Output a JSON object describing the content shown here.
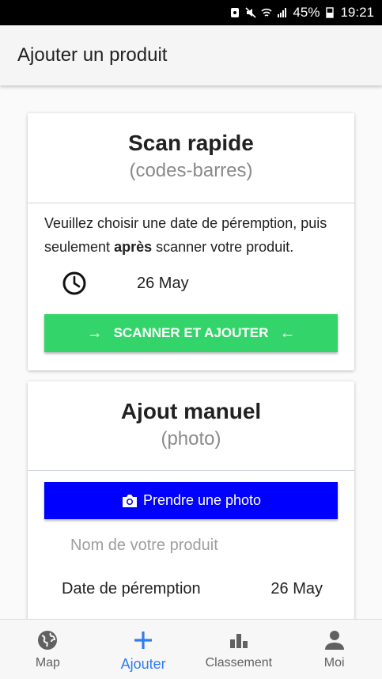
{
  "status_bar": {
    "battery": "45%",
    "time": "19:21"
  },
  "app_bar": {
    "title": "Ajouter un produit"
  },
  "quick_scan": {
    "title": "Scan rapide",
    "subtitle": "(codes-barres)",
    "instruction_part1": "Veuillez choisir une date de péremption, puis seulement ",
    "instruction_bold": "après",
    "instruction_part2": " scanner votre produit.",
    "date_value": "26 May",
    "scan_button_label": "SCANNER ET AJOUTER",
    "icons": [
      "clock-icon",
      "arrow-right-icon",
      "arrow-left-icon"
    ]
  },
  "manual_add": {
    "title": "Ajout manuel",
    "subtitle": "(photo)",
    "photo_button_label": "Prendre une photo",
    "name_placeholder": "Nom de votre produit",
    "name_value": "",
    "expiry_label": "Date de péremption",
    "expiry_value": "26 May",
    "icons": [
      "camera-icon"
    ]
  },
  "bottom_nav": {
    "items": [
      {
        "label": "Map",
        "icon": "globe-icon"
      },
      {
        "label": "Ajouter",
        "icon": "plus-icon",
        "active": true
      },
      {
        "label": "Classement",
        "icon": "bar-chart-icon"
      },
      {
        "label": "Moi",
        "icon": "person-icon"
      }
    ]
  },
  "colors": {
    "scan_button": "#33d46a",
    "photo_button": "#0000ff",
    "active_nav": "#2e7cf6"
  }
}
